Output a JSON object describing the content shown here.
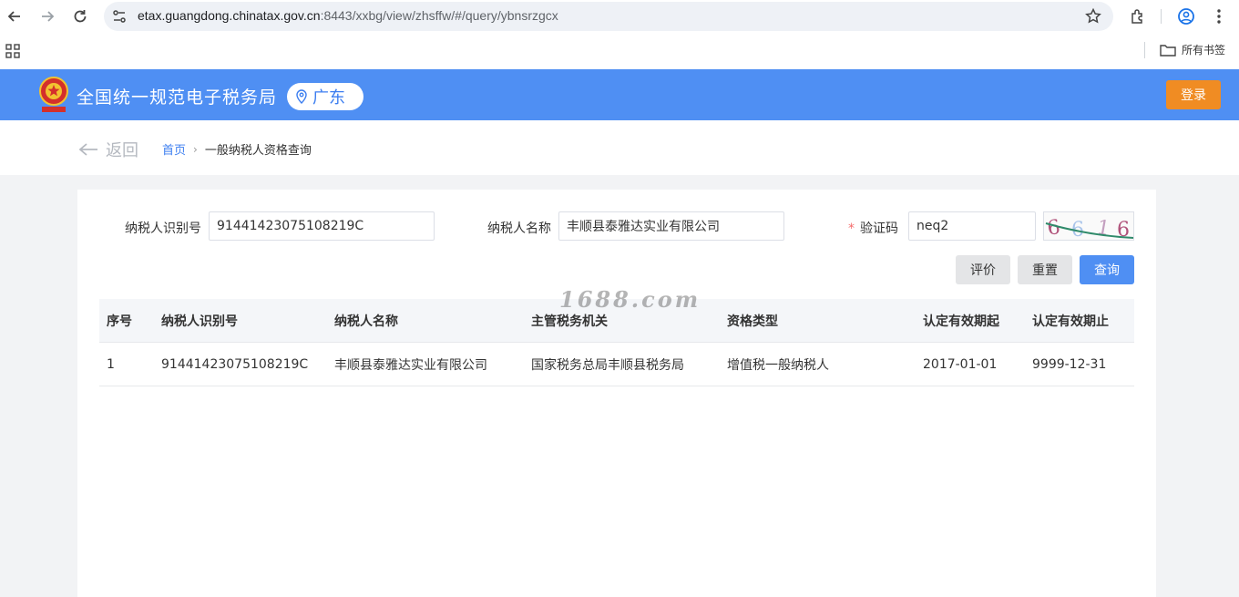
{
  "browser": {
    "url_host": "etax.guangdong.chinatax.gov.cn",
    "url_rest": ":8443/xxbg/view/zhsffw/#/query/ybnsrzgcx",
    "bookmarks_label": "所有书签"
  },
  "header": {
    "site_title": "全国统一规范电子税务局",
    "region": "广东",
    "login_label": "登录"
  },
  "breadcrumb": {
    "back_label": "返回",
    "home": "首页",
    "separator": "›",
    "current": "一般纳税人资格查询"
  },
  "form": {
    "taxpayer_id_label": "纳税人识别号",
    "taxpayer_id_value": "91441423075108219C",
    "taxpayer_name_label": "纳税人名称",
    "taxpayer_name_value": "丰顺县泰雅达实业有限公司",
    "captcha_required_mark": "*",
    "captcha_label": "验证码",
    "captcha_value": "neq2",
    "captcha_image_text": "6616"
  },
  "buttons": {
    "evaluate": "评价",
    "reset": "重置",
    "query": "查询"
  },
  "table": {
    "headers": [
      "序号",
      "纳税人识别号",
      "纳税人名称",
      "主管税务机关",
      "资格类型",
      "认定有效期起",
      "认定有效期止"
    ],
    "rows": [
      [
        "1",
        "91441423075108219C",
        "丰顺县泰雅达实业有限公司",
        "国家税务总局丰顺县税务局",
        "增值税一般纳税人",
        "2017-01-01",
        "9999-12-31"
      ]
    ]
  },
  "watermark": "1688.com",
  "colors": {
    "header_blue": "#4f8ff3",
    "login_orange": "#f08c23",
    "link_blue": "#3c7ef0",
    "required_red": "#f56c6c"
  }
}
